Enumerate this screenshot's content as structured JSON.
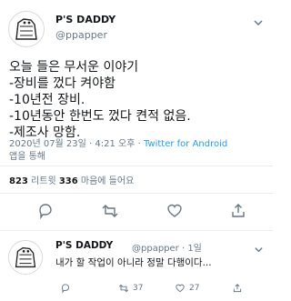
{
  "tweet": {
    "display_name": "P'S DADDY",
    "handle": "@ppapper",
    "avatar_icon": "cartoon-avatar-icon",
    "more_icon": "chevron-down-icon",
    "lines": [
      "오늘 들은 무서운 이야기",
      "-장비를 껐다 켜야함",
      "-10년전 장비.",
      "-10년동안 한번도 껐다 켠적 없음.",
      "-제조사 망함."
    ],
    "timestamp": "2020년 07월 23일 · 4:21 오후 · ",
    "via": "Twitter for Android",
    "via_suffix": "앱을 통해"
  },
  "stats": {
    "retweets_count": "823",
    "retweets_label": " 리트윗  ",
    "likes_count": "336",
    "likes_label": " 마음에 들어요"
  },
  "actions": [
    {
      "name": "reply-icon"
    },
    {
      "name": "retweet-icon"
    },
    {
      "name": "like-icon"
    },
    {
      "name": "share-icon"
    }
  ],
  "reply": {
    "display_name": "P'S DADDY",
    "handle_time": "@ppapper · 1일",
    "text": "내가 할 작업이 아니라 정말 다행이다...",
    "more_icon": "chevron-down-icon",
    "retweet_count": "37",
    "like_count": "27"
  },
  "colors": {
    "accent": "#1da1f2",
    "secondary_text": "#657786",
    "primary_text": "#14171a",
    "divider": "#e6ecf0"
  }
}
